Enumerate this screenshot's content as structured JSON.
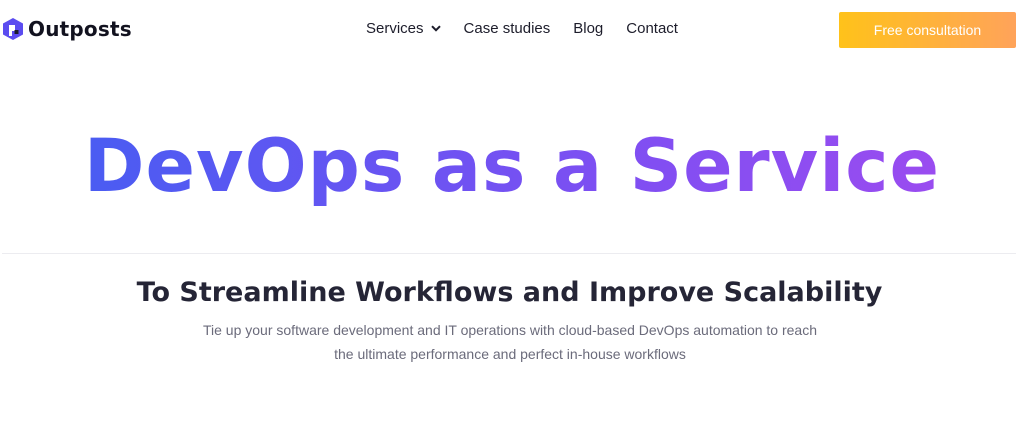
{
  "header": {
    "logo_text": "Outposts",
    "nav": [
      {
        "label": "Services",
        "has_dropdown": true
      },
      {
        "label": "Case studies"
      },
      {
        "label": "Blog"
      },
      {
        "label": "Contact"
      }
    ],
    "cta_label": "Free consultation"
  },
  "hero": {
    "title": "DevOps as a Service",
    "subtitle": "To Streamline Workflows and Improve Scalability",
    "description": "Tie up your software development and IT operations with cloud-based DevOps automation to reach the ultimate performance and perfect in-house workflows"
  },
  "icons": {
    "logo": "outposts-logo-icon",
    "dropdown": "chevron-down-icon"
  },
  "colors": {
    "cta_gradient_start": "#ffc21a",
    "cta_gradient_end": "#ffa35a",
    "title_gradient_start": "#4a5cf2",
    "title_gradient_end": "#9a4cf0",
    "text_dark": "#252536",
    "text_muted": "#6b6b7b"
  }
}
